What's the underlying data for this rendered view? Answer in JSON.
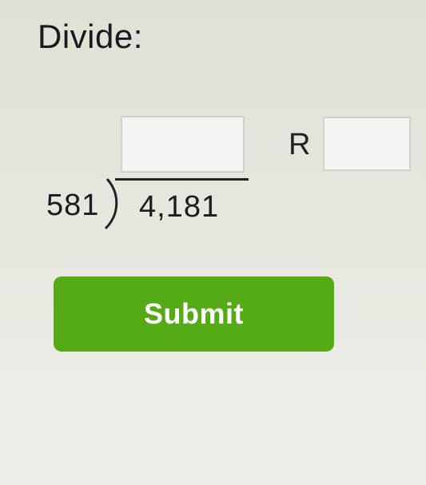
{
  "problem": {
    "prompt": "Divide:",
    "divisor": "581",
    "dividend": "4,181",
    "remainder_label": "R"
  },
  "inputs": {
    "quotient_value": "",
    "remainder_value": ""
  },
  "submit": {
    "label": "Submit"
  },
  "colors": {
    "submit_background": "#54ab16",
    "submit_text": "#ffffff",
    "page_background": "#e6e7df"
  }
}
